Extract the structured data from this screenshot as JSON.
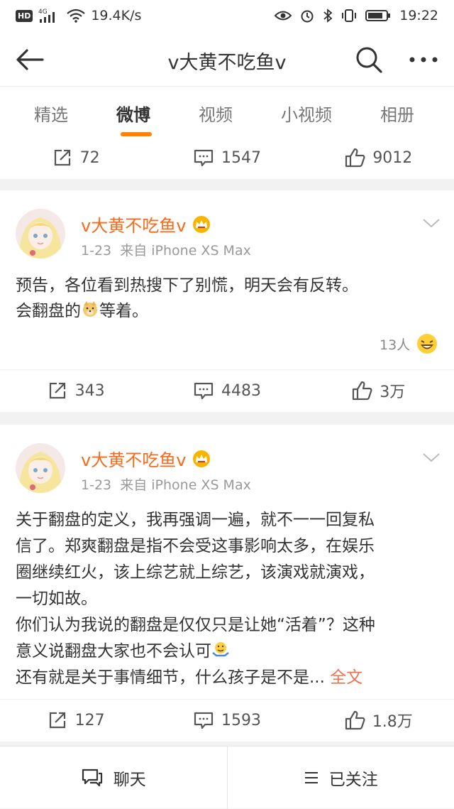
{
  "status_bar": {
    "network": "4G",
    "speed": "19.4K/s",
    "time": "19:22"
  },
  "header": {
    "title": "v大黄不吃鱼v"
  },
  "tabs": [
    {
      "label": "精选"
    },
    {
      "label": "微博"
    },
    {
      "label": "视频"
    },
    {
      "label": "小视频"
    },
    {
      "label": "相册"
    }
  ],
  "top_stats": {
    "reposts": "72",
    "comments": "1547",
    "likes": "9012"
  },
  "posts": [
    {
      "author": "v大黄不吃鱼v",
      "date": "1-23",
      "source": "来自 iPhone XS Max",
      "lines": [
        "预告，各位看到热搜下了别慌，明天会有反转。",
        "会翻盘的",
        "等着。"
      ],
      "likers": "13人",
      "reposts": "343",
      "comments": "4483",
      "likes": "3万"
    },
    {
      "author": "v大黄不吃鱼v",
      "date": "1-23",
      "source": "来自 iPhone XS Max",
      "lines": [
        "关于翻盘的定义，我再强调一遍，就不一一回复私",
        "信了。郑爽翻盘是指不会受这事影响太多，在娱乐",
        "圈继续红火，该上综艺就上综艺，该演戏就演戏，",
        "一切如故。",
        "你们认为我说的翻盘是仅仅只是让她“活着”？这种",
        "意义说翻盘大家也不会认可",
        "还有就是关于事情细节，什么孩子是不是..."
      ],
      "full_text_link": "全文",
      "reposts": "127",
      "comments": "1593",
      "likes": "1.8万"
    }
  ],
  "bottom_bar": {
    "chat_label": "聊天",
    "follow_label": "已关注"
  },
  "colors": {
    "accent": "#ff8200",
    "author": "#f86a1a",
    "link": "#eb7350"
  }
}
